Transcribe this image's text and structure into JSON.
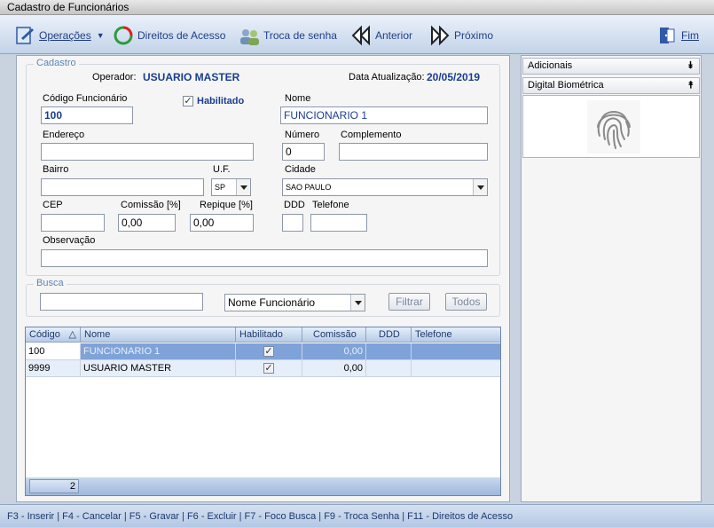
{
  "window": {
    "title": "Cadastro de Funcionários"
  },
  "toolbar": {
    "operacoes": "Operações",
    "direitos": "Direitos de Acesso",
    "troca_senha": "Troca de senha",
    "anterior": "Anterior",
    "proximo": "Próximo",
    "fim": "Fim"
  },
  "cadastro": {
    "group_title": "Cadastro",
    "operador_label": "Operador:",
    "operador_value": "USUARIO MASTER",
    "data_label": "Data Atualização:",
    "data_value": "20/05/2019",
    "codigo_label": "Código Funcionário",
    "codigo_value": "100",
    "habilitado_label": "Habilitado",
    "nome_label": "Nome",
    "nome_value": "FUNCIONARIO 1",
    "endereco_label": "Endereço",
    "endereco_value": "",
    "numero_label": "Número",
    "numero_value": "0",
    "complemento_label": "Complemento",
    "complemento_value": "",
    "bairro_label": "Bairro",
    "bairro_value": "",
    "uf_label": "U.F.",
    "uf_value": "SP",
    "cidade_label": "Cidade",
    "cidade_value": "SAO PAULO",
    "cep_label": "CEP",
    "cep_value": "",
    "comissao_label": "Comissão [%]",
    "comissao_value": "0,00",
    "repique_label": "Repique [%]",
    "repique_value": "0,00",
    "ddd_label": "DDD",
    "ddd_value": "",
    "telefone_label": "Telefone",
    "telefone_value": "",
    "observacao_label": "Observação",
    "observacao_value": ""
  },
  "busca": {
    "group_title": "Busca",
    "search_value": "",
    "field_selected": "Nome Funcionário",
    "filtrar": "Filtrar",
    "todos": "Todos"
  },
  "grid": {
    "headers": [
      "Código",
      "Nome",
      "Habilitado",
      "Comissão",
      "DDD",
      "Telefone"
    ],
    "sort_indicator": "△",
    "rows": [
      {
        "codigo": "100",
        "nome": "FUNCIONARIO 1",
        "habilitado": true,
        "comissao": "0,00",
        "ddd": "",
        "telefone": ""
      },
      {
        "codigo": "9999",
        "nome": "USUARIO MASTER",
        "habilitado": true,
        "comissao": "0,00",
        "ddd": "",
        "telefone": ""
      }
    ],
    "footer_count": "2"
  },
  "side": {
    "adicionais": "Adicionais",
    "digital": "Digital Biométrica"
  },
  "statusbar": {
    "text": "F3 - Inserir   |   F4 - Cancelar   |   F5 - Gravar   |   F6 - Excluir   |   F7 - Foco Busca   |   F9 - Troca Senha   |   F11 - Direitos de Acesso"
  },
  "colors": {
    "accent": "#1f3f86",
    "selected_row": "#7fa3d8",
    "alt_row": "#e6eef9"
  },
  "icons": [
    "operacoes-icon",
    "direitos-icon",
    "troca-senha-icon",
    "anterior-icon",
    "proximo-icon",
    "fim-icon",
    "fingerprint-icon"
  ]
}
